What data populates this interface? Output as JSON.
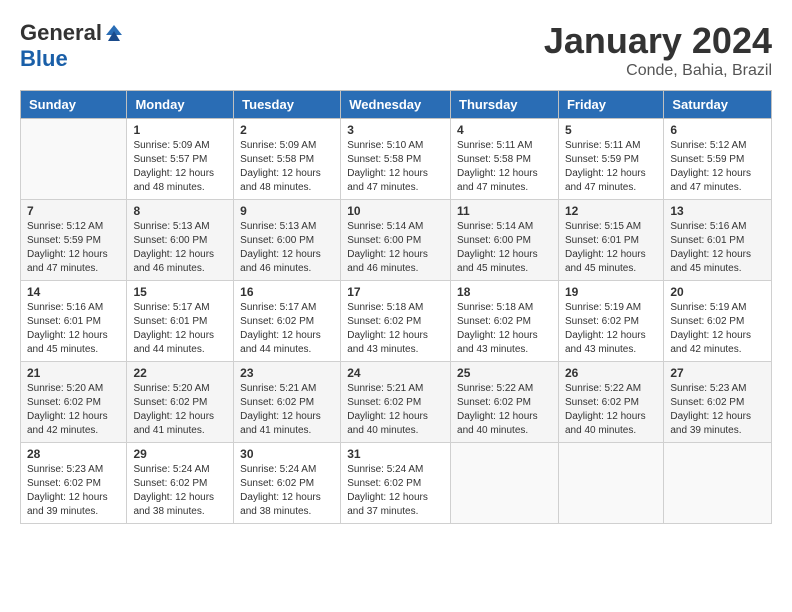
{
  "header": {
    "logo_general": "General",
    "logo_blue": "Blue",
    "title": "January 2024",
    "location": "Conde, Bahia, Brazil"
  },
  "calendar": {
    "days_of_week": [
      "Sunday",
      "Monday",
      "Tuesday",
      "Wednesday",
      "Thursday",
      "Friday",
      "Saturday"
    ],
    "weeks": [
      [
        {
          "day": null,
          "info": null
        },
        {
          "day": "1",
          "info": "Sunrise: 5:09 AM\nSunset: 5:57 PM\nDaylight: 12 hours\nand 48 minutes."
        },
        {
          "day": "2",
          "info": "Sunrise: 5:09 AM\nSunset: 5:58 PM\nDaylight: 12 hours\nand 48 minutes."
        },
        {
          "day": "3",
          "info": "Sunrise: 5:10 AM\nSunset: 5:58 PM\nDaylight: 12 hours\nand 47 minutes."
        },
        {
          "day": "4",
          "info": "Sunrise: 5:11 AM\nSunset: 5:58 PM\nDaylight: 12 hours\nand 47 minutes."
        },
        {
          "day": "5",
          "info": "Sunrise: 5:11 AM\nSunset: 5:59 PM\nDaylight: 12 hours\nand 47 minutes."
        },
        {
          "day": "6",
          "info": "Sunrise: 5:12 AM\nSunset: 5:59 PM\nDaylight: 12 hours\nand 47 minutes."
        }
      ],
      [
        {
          "day": "7",
          "info": "Sunrise: 5:12 AM\nSunset: 5:59 PM\nDaylight: 12 hours\nand 47 minutes."
        },
        {
          "day": "8",
          "info": "Sunrise: 5:13 AM\nSunset: 6:00 PM\nDaylight: 12 hours\nand 46 minutes."
        },
        {
          "day": "9",
          "info": "Sunrise: 5:13 AM\nSunset: 6:00 PM\nDaylight: 12 hours\nand 46 minutes."
        },
        {
          "day": "10",
          "info": "Sunrise: 5:14 AM\nSunset: 6:00 PM\nDaylight: 12 hours\nand 46 minutes."
        },
        {
          "day": "11",
          "info": "Sunrise: 5:14 AM\nSunset: 6:00 PM\nDaylight: 12 hours\nand 45 minutes."
        },
        {
          "day": "12",
          "info": "Sunrise: 5:15 AM\nSunset: 6:01 PM\nDaylight: 12 hours\nand 45 minutes."
        },
        {
          "day": "13",
          "info": "Sunrise: 5:16 AM\nSunset: 6:01 PM\nDaylight: 12 hours\nand 45 minutes."
        }
      ],
      [
        {
          "day": "14",
          "info": "Sunrise: 5:16 AM\nSunset: 6:01 PM\nDaylight: 12 hours\nand 45 minutes."
        },
        {
          "day": "15",
          "info": "Sunrise: 5:17 AM\nSunset: 6:01 PM\nDaylight: 12 hours\nand 44 minutes."
        },
        {
          "day": "16",
          "info": "Sunrise: 5:17 AM\nSunset: 6:02 PM\nDaylight: 12 hours\nand 44 minutes."
        },
        {
          "day": "17",
          "info": "Sunrise: 5:18 AM\nSunset: 6:02 PM\nDaylight: 12 hours\nand 43 minutes."
        },
        {
          "day": "18",
          "info": "Sunrise: 5:18 AM\nSunset: 6:02 PM\nDaylight: 12 hours\nand 43 minutes."
        },
        {
          "day": "19",
          "info": "Sunrise: 5:19 AM\nSunset: 6:02 PM\nDaylight: 12 hours\nand 43 minutes."
        },
        {
          "day": "20",
          "info": "Sunrise: 5:19 AM\nSunset: 6:02 PM\nDaylight: 12 hours\nand 42 minutes."
        }
      ],
      [
        {
          "day": "21",
          "info": "Sunrise: 5:20 AM\nSunset: 6:02 PM\nDaylight: 12 hours\nand 42 minutes."
        },
        {
          "day": "22",
          "info": "Sunrise: 5:20 AM\nSunset: 6:02 PM\nDaylight: 12 hours\nand 41 minutes."
        },
        {
          "day": "23",
          "info": "Sunrise: 5:21 AM\nSunset: 6:02 PM\nDaylight: 12 hours\nand 41 minutes."
        },
        {
          "day": "24",
          "info": "Sunrise: 5:21 AM\nSunset: 6:02 PM\nDaylight: 12 hours\nand 40 minutes."
        },
        {
          "day": "25",
          "info": "Sunrise: 5:22 AM\nSunset: 6:02 PM\nDaylight: 12 hours\nand 40 minutes."
        },
        {
          "day": "26",
          "info": "Sunrise: 5:22 AM\nSunset: 6:02 PM\nDaylight: 12 hours\nand 40 minutes."
        },
        {
          "day": "27",
          "info": "Sunrise: 5:23 AM\nSunset: 6:02 PM\nDaylight: 12 hours\nand 39 minutes."
        }
      ],
      [
        {
          "day": "28",
          "info": "Sunrise: 5:23 AM\nSunset: 6:02 PM\nDaylight: 12 hours\nand 39 minutes."
        },
        {
          "day": "29",
          "info": "Sunrise: 5:24 AM\nSunset: 6:02 PM\nDaylight: 12 hours\nand 38 minutes."
        },
        {
          "day": "30",
          "info": "Sunrise: 5:24 AM\nSunset: 6:02 PM\nDaylight: 12 hours\nand 38 minutes."
        },
        {
          "day": "31",
          "info": "Sunrise: 5:24 AM\nSunset: 6:02 PM\nDaylight: 12 hours\nand 37 minutes."
        },
        {
          "day": null,
          "info": null
        },
        {
          "day": null,
          "info": null
        },
        {
          "day": null,
          "info": null
        }
      ]
    ]
  }
}
